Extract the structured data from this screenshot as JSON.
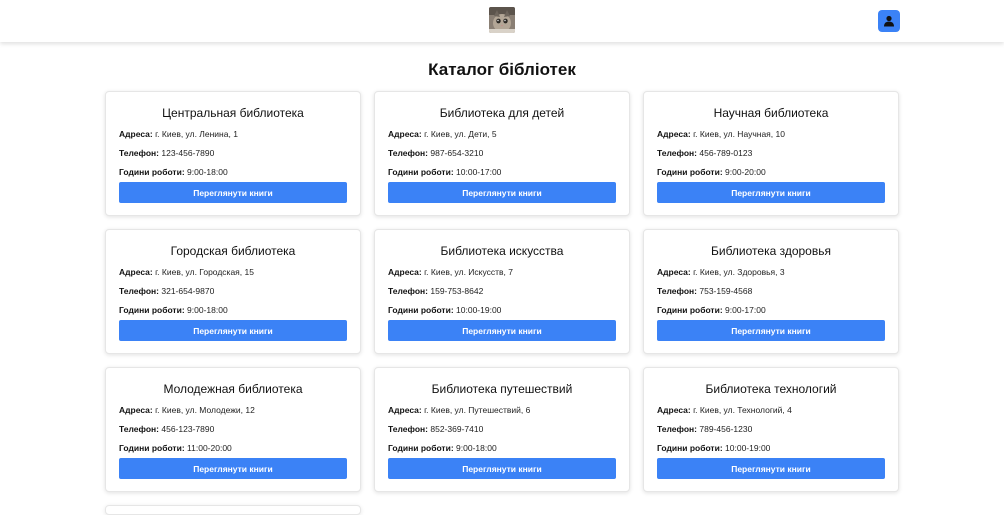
{
  "header": {
    "logo_icon": "cat-photo-logo-icon",
    "profile_icon": "user-icon",
    "accent_color": "#3b82f6"
  },
  "page_title": "Каталог бібліотек",
  "labels": {
    "address": "Адреса:",
    "phone": "Телефон:",
    "hours": "Години роботи:"
  },
  "libraries": [
    {
      "name": "Центральная библиотека",
      "address": "г. Киев, ул. Ленина, 1",
      "phone": "123-456-7890",
      "hours": "9:00-18:00",
      "button": "Переглянути книги"
    },
    {
      "name": "Библиотека для детей",
      "address": "г. Киев, ул. Дети, 5",
      "phone": "987-654-3210",
      "hours": "10:00-17:00",
      "button": "Переглянути книги"
    },
    {
      "name": "Научная библиотека",
      "address": "г. Киев, ул. Научная, 10",
      "phone": "456-789-0123",
      "hours": "9:00-20:00",
      "button": "Переглянути книги"
    },
    {
      "name": "Городская библиотека",
      "address": "г. Киев, ул. Городская, 15",
      "phone": "321-654-9870",
      "hours": "9:00-18:00",
      "button": "Переглянути книги"
    },
    {
      "name": "Библиотека искусства",
      "address": "г. Киев, ул. Искусств, 7",
      "phone": "159-753-8642",
      "hours": "10:00-19:00",
      "button": "Переглянути книги"
    },
    {
      "name": "Библиотека здоровья",
      "address": "г. Киев, ул. Здоровья, 3",
      "phone": "753-159-4568",
      "hours": "9:00-17:00",
      "button": "Переглянути книги"
    },
    {
      "name": "Молодежная библиотека",
      "address": "г. Киев, ул. Молодежи, 12",
      "phone": "456-123-7890",
      "hours": "11:00-20:00",
      "button": "Переглянути книги"
    },
    {
      "name": "Библиотека путешествий",
      "address": "г. Киев, ул. Путешествий, 6",
      "phone": "852-369-7410",
      "hours": "9:00-18:00",
      "button": "Переглянути книги"
    },
    {
      "name": "Библиотека технологий",
      "address": "г. Киев, ул. Технологий, 4",
      "phone": "789-456-1230",
      "hours": "10:00-19:00",
      "button": "Переглянути книги"
    }
  ]
}
